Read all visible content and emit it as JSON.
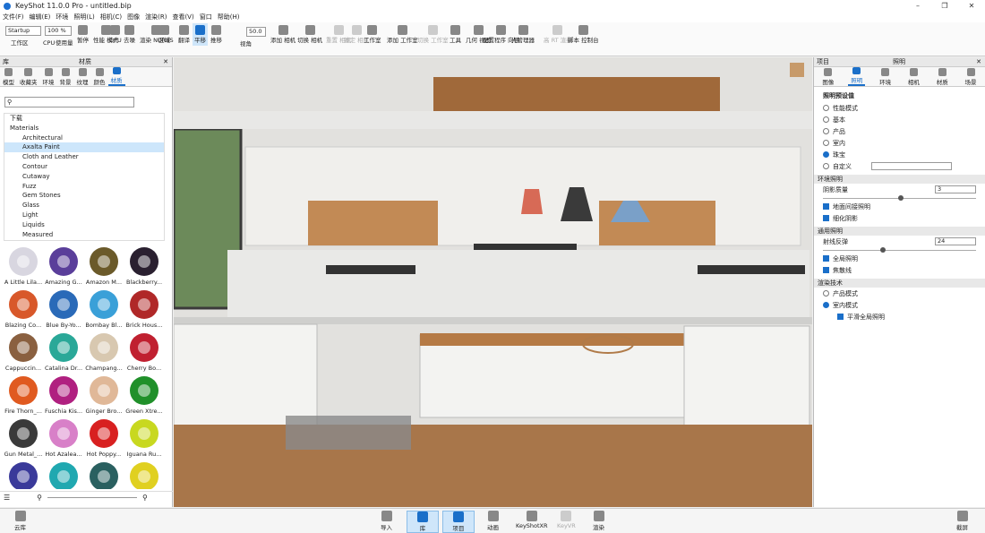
{
  "titlebar": {
    "title": "KeyShot 11.0.0 Pro  -  untitled.bip",
    "min": "–",
    "max": "❐",
    "close": "✕"
  },
  "menu": [
    "文件(F)",
    "编辑(E)",
    "环境",
    "照明(L)",
    "相机(C)",
    "图像",
    "渲染(R)",
    "查看(V)",
    "窗口",
    "帮助(H)"
  ],
  "toolbar": {
    "workspace_select": "Startup",
    "zoom_select": "100 %",
    "fov_value": "50.0",
    "items": {
      "workspace": "工作区",
      "cpu": "CPU",
      "usage": "使用量",
      "pause": "暂停",
      "perf": "性能\n模式",
      "gpu": "GPU",
      "denoise": "去噪",
      "nurbs": "渲染\nNURBS",
      "region": "区域",
      "translate": "翻译",
      "pan": "平移",
      "push": "推移",
      "fov": "视角",
      "add_camera": "添加\n相机",
      "switch_camera": "切换\n相机",
      "reset_camera": "重置\n相机",
      "lock_camera": "锁定\n相机",
      "studio": "工作室",
      "add_studio": "添加\n工作室",
      "switch_studio": "切换\n工作室",
      "tools": "工具",
      "geo": "几何\n视图",
      "config": "配置程序\n向导",
      "light_mgr": "光管理器",
      "rt": "高 RT\n渲染",
      "script": "脚本\n控制台"
    }
  },
  "left": {
    "head_lib": "库",
    "head_mat": "材质",
    "tabs": [
      "模型",
      "收藏夹",
      "环境",
      "背景",
      "纹理",
      "颜色",
      "材质"
    ],
    "tree": [
      "下载",
      "Materials",
      "Architectural",
      "Axalta Paint",
      "Cloth and Leather",
      "Contour",
      "Cutaway",
      "Fuzz",
      "Gem Stones",
      "Glass",
      "Light",
      "Liquids",
      "Measured"
    ],
    "thumbs": [
      {
        "n": "A Little Lila...",
        "c": "#d8d6e0"
      },
      {
        "n": "Amazing G...",
        "c": "#5a3e9a"
      },
      {
        "n": "Amazon M...",
        "c": "#6b5a2a"
      },
      {
        "n": "Blackberry...",
        "c": "#2a2030"
      },
      {
        "n": "Blazing Co...",
        "c": "#d8582a"
      },
      {
        "n": "Blue By-Yo...",
        "c": "#2a6ab8"
      },
      {
        "n": "Bombay Bl...",
        "c": "#3aa0d8"
      },
      {
        "n": "Brick Hous...",
        "c": "#b02828"
      },
      {
        "n": "Cappuccin...",
        "c": "#8a6040"
      },
      {
        "n": "Catalina Dr...",
        "c": "#2aa898"
      },
      {
        "n": "Champang...",
        "c": "#d8c8b0"
      },
      {
        "n": "Cherry Bo...",
        "c": "#c02030"
      },
      {
        "n": "Fire Thorn_...",
        "c": "#e05a20"
      },
      {
        "n": "Fuschia Kis...",
        "c": "#b02080"
      },
      {
        "n": "Ginger Bro...",
        "c": "#e0b898"
      },
      {
        "n": "Green Xtre...",
        "c": "#20902a"
      },
      {
        "n": "Gun Metal_...",
        "c": "#3a3a3a"
      },
      {
        "n": "Hot Azalea...",
        "c": "#d880c8"
      },
      {
        "n": "Hot Poppy...",
        "c": "#d82020"
      },
      {
        "n": "Iguana Ru...",
        "c": "#c8d820"
      },
      {
        "n": "",
        "c": "#3a3a9a"
      },
      {
        "n": "",
        "c": "#20a8b0"
      },
      {
        "n": "",
        "c": "#2a6060"
      },
      {
        "n": "",
        "c": "#e0d020"
      }
    ]
  },
  "right": {
    "head_proj": "项目",
    "head_light": "照明",
    "tabs": [
      "图像",
      "照明",
      "环境",
      "相机",
      "材质",
      "场景"
    ],
    "preset_title": "照明预设值",
    "presets": [
      "性能模式",
      "基本",
      "产品",
      "室内",
      "珠宝",
      "自定义"
    ],
    "preset_selected": 4,
    "env_title": "环境照明",
    "shadow_label": "阴影质量",
    "shadow_val": "3",
    "ground_label": "地面间接照明",
    "detail_shadow": "细化阴影",
    "general_title": "通用照明",
    "ray_label": "射线反弹",
    "ray_val": "24",
    "gi_label": "全局照明",
    "caustics": "焦散线",
    "render_title": "渲染技术",
    "tech": [
      "产品模式",
      "室内模式"
    ],
    "tech_selected": 1,
    "smooth_label": "平滑全局照明"
  },
  "bottom": {
    "cloud": "云库",
    "items": [
      "导入",
      "库",
      "项目",
      "动画",
      "KeyShotXR",
      "KeyVR",
      "渲染"
    ],
    "screenshot": "截屏"
  }
}
